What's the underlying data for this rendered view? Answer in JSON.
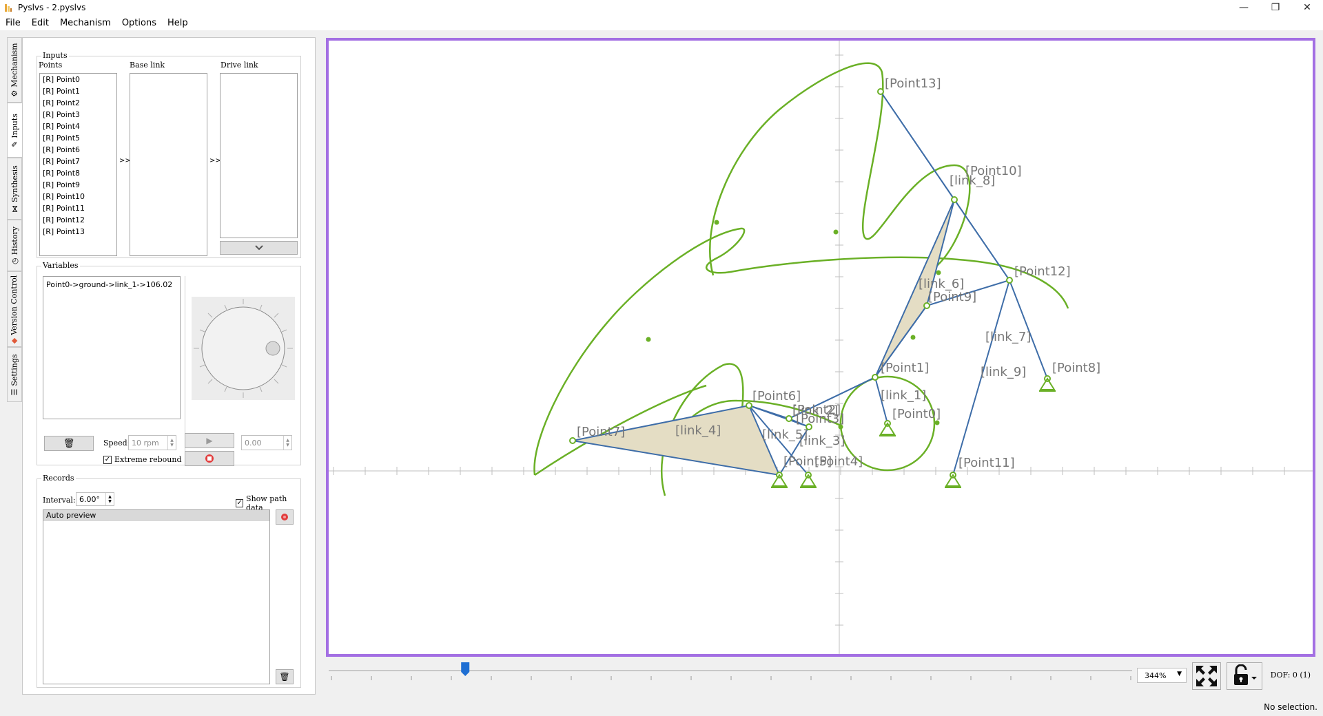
{
  "window": {
    "title": "Pyslvs - 2.pyslvs",
    "minimize": "—",
    "maximize": "❐",
    "close": "✕"
  },
  "menu": {
    "items": [
      "File",
      "Edit",
      "Mechanism",
      "Options",
      "Help"
    ]
  },
  "vtabs": [
    "Mechanism",
    "Inputs",
    "Synthesis",
    "History",
    "Version Control",
    "Settings"
  ],
  "inputs": {
    "group_title": "Inputs",
    "points_label": "Points",
    "base_link_label": "Base link",
    "drive_link_label": "Drive link",
    "points": [
      "[R] Point0",
      "[R] Point1",
      "[R] Point2",
      "[R] Point3",
      "[R] Point4",
      "[R] Point5",
      "[R] Point6",
      "[R] Point7",
      "[R] Point8",
      "[R] Point9",
      "[R] Point10",
      "[R] Point11",
      "[R] Point12",
      "[R] Point13"
    ],
    "arrow1": ">>",
    "arrow2": ">>"
  },
  "variables": {
    "group_title": "Variables",
    "items": [
      "Point0->ground->link_1->106.02"
    ],
    "speed_label": "Speed:",
    "speed_value": "10 rpm",
    "extreme_rebound_label": "Extreme rebound",
    "extreme_rebound_checked": true,
    "angle_value": "0.00"
  },
  "records": {
    "group_title": "Records",
    "interval_label": "Interval:",
    "interval_value": "6.00°",
    "show_path_label": "Show path data",
    "show_path_checked": true,
    "items": [
      "Auto preview"
    ]
  },
  "canvas": {
    "points": [
      "[Point0]",
      "[Point1]",
      "[Point2]",
      "[Point3]",
      "[Point4]",
      "[Point5]",
      "[Point6]",
      "[Point7]",
      "[Point8]",
      "[Point9]",
      "[Point10]",
      "[Point11]",
      "[Point12]",
      "[Point13]"
    ],
    "links": [
      "[link_1]",
      "[link_2]",
      "[link_3]",
      "[link_4]",
      "[link_5]",
      "[link_6]",
      "[link_7]",
      "[link_8]",
      "[link_9]"
    ],
    "colors": {
      "frame": "#a36fe3",
      "link": "#3e6da8",
      "path": "#6ab026",
      "link_fill": "#e4ddc4",
      "axis": "#bfbfbf"
    }
  },
  "bottom": {
    "zoom": "344%",
    "dof_label": "DOF: 0 (1)",
    "slider_fraction": 0.17
  },
  "status": {
    "text": "No selection."
  }
}
